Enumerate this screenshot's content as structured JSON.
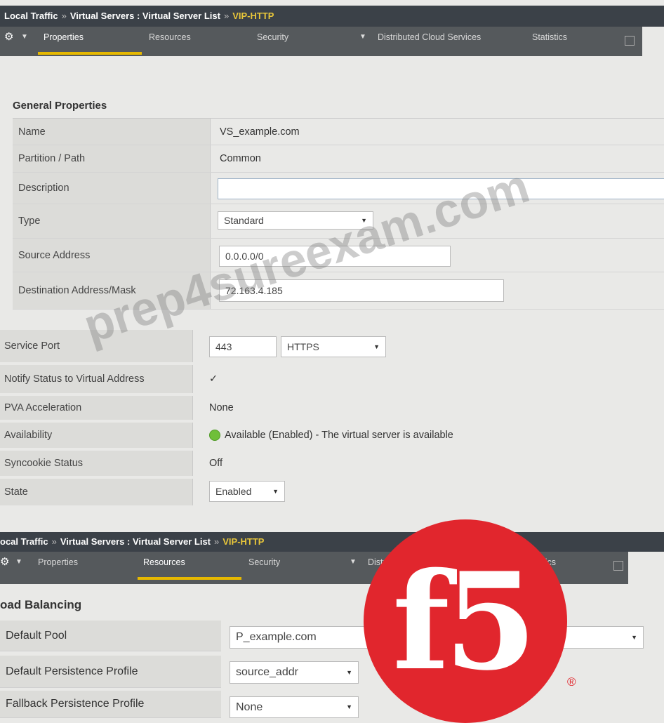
{
  "breadcrumb": {
    "part1": "Local Traffic",
    "sep1": "»",
    "part2": "Virtual Servers : Virtual Server List",
    "sep2": "»",
    "current": "VIP-HTTP"
  },
  "breadcrumb2": {
    "part1": "ocal Traffic",
    "sep1": "»",
    "part2": "Virtual Servers : Virtual Server List",
    "sep2": "»",
    "current": "VIP-HTTP"
  },
  "tabs": {
    "gear": "⚙",
    "items": [
      "Properties",
      "Resources",
      "Security",
      "Distributed Cloud Services",
      "Statistics"
    ]
  },
  "general": {
    "title": "General Properties",
    "rows": {
      "name": {
        "label": "Name",
        "value": "VS_example.com"
      },
      "partition": {
        "label": "Partition / Path",
        "value": "Common"
      },
      "description": {
        "label": "Description",
        "value": ""
      },
      "type": {
        "label": "Type",
        "value": "Standard"
      },
      "source": {
        "label": "Source Address",
        "value": "0.0.0.0/0"
      },
      "destination": {
        "label": "Destination Address/Mask",
        "value": "72.163.4.185"
      }
    }
  },
  "props": {
    "service_port": {
      "label": "Service Port",
      "port": "443",
      "protocol": "HTTPS"
    },
    "notify": {
      "label": "Notify Status to Virtual Address",
      "value": "✓"
    },
    "pva": {
      "label": "PVA Acceleration",
      "value": "None"
    },
    "availability": {
      "label": "Availability",
      "value": "Available (Enabled) - The virtual server is available"
    },
    "syncookie": {
      "label": "Syncookie Status",
      "value": "Off"
    },
    "state": {
      "label": "State",
      "value": "Enabled"
    }
  },
  "load_balancing": {
    "title": "oad Balancing",
    "default_pool": {
      "label": "Default Pool",
      "value": "P_example.com"
    },
    "default_persist": {
      "label": "Default Persistence Profile",
      "value": "source_addr"
    },
    "fallback_persist": {
      "label": "Fallback Persistence Profile",
      "value": "None"
    }
  },
  "watermark": "prep4sureexam.com",
  "logo": {
    "text": "f5",
    "reg": "®"
  },
  "colors": {
    "brand_red": "#e1262d",
    "tab_active_underline": "#e6b800",
    "breadcrumb_current": "#e8c63a"
  }
}
